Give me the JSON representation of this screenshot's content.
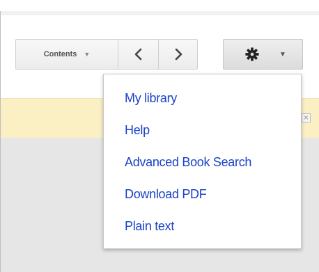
{
  "toolbar": {
    "contents_label": "Contents",
    "contents_caret": "▼",
    "prev_icon": "chevron-left-icon",
    "next_icon": "chevron-right-icon",
    "settings_icon": "gear-icon",
    "settings_caret": "▼"
  },
  "notice": {
    "close_glyph": "×"
  },
  "menu": {
    "items": [
      {
        "label": "My library"
      },
      {
        "label": "Help"
      },
      {
        "label": "Advanced Book Search"
      },
      {
        "label": "Download PDF"
      },
      {
        "label": "Plain text"
      }
    ]
  },
  "colors": {
    "link": "#1a43c8",
    "notice_bg": "#fbefc4",
    "panel_bg": "#e6e6e6"
  }
}
